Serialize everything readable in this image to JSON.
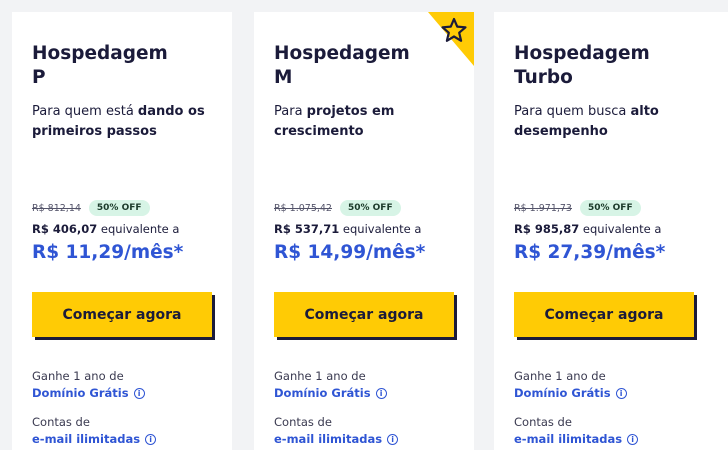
{
  "plans": [
    {
      "title": "Hospedagem P",
      "desc_prefix": "Para quem está ",
      "desc_bold": "dando os primeiros passos",
      "old_price": "R$ 812,14",
      "discount": "50% OFF",
      "total_price": "R$ 406,07",
      "equiv_text": " equivalente a",
      "monthly_price": "R$ 11,29/mês*",
      "cta_label": "Começar agora",
      "feature1_prefix": "Ganhe 1 ano de",
      "feature1_link": "Domínio Grátis",
      "feature2_prefix": "Contas de",
      "feature2_link": "e-mail ilimitadas",
      "featured": false
    },
    {
      "title": "Hospedagem M",
      "desc_prefix": "Para ",
      "desc_bold": "projetos em crescimento",
      "old_price": "R$ 1.075,42",
      "discount": "50% OFF",
      "total_price": "R$ 537,71",
      "equiv_text": " equivalente a",
      "monthly_price": "R$ 14,99/mês*",
      "cta_label": "Começar agora",
      "feature1_prefix": "Ganhe 1 ano de",
      "feature1_link": "Domínio Grátis",
      "feature2_prefix": "Contas de",
      "feature2_link": "e-mail ilimitadas",
      "featured": true
    },
    {
      "title": "Hospedagem Turbo",
      "desc_prefix": "Para quem busca ",
      "desc_bold": "alto desempenho",
      "old_price": "R$ 1.971,73",
      "discount": "50% OFF",
      "total_price": "R$ 985,87",
      "equiv_text": " equivalente a",
      "monthly_price": "R$ 27,39/mês*",
      "cta_label": "Começar agora",
      "feature1_prefix": "Ganhe 1 ano de",
      "feature1_link": "Domínio Grátis",
      "feature2_prefix": "Contas de",
      "feature2_link": "e-mail ilimitadas",
      "featured": false
    }
  ],
  "icons": {
    "info": "i",
    "featured": "star-icon"
  },
  "colors": {
    "accent_yellow": "#ffcb05",
    "price_blue": "#2f55d4",
    "text_dark": "#1b1b3a",
    "badge_green": "#d7f4e6"
  }
}
